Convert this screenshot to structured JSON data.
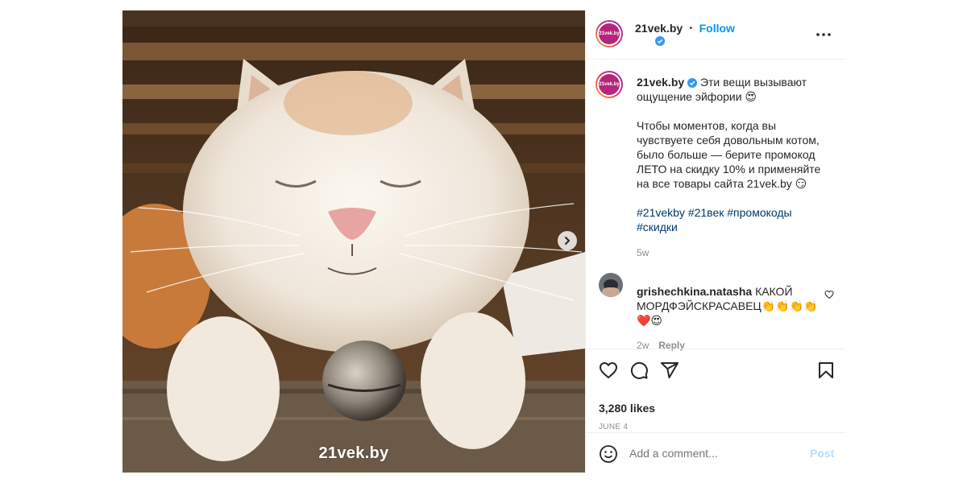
{
  "media": {
    "watermark": "21vek.by"
  },
  "header": {
    "username": "21vek.by",
    "separator": "•",
    "follow_label": "Follow",
    "more_label": "•••",
    "avatar_text": "21vek.by"
  },
  "caption": {
    "username": "21vek.by",
    "line1": "Эти вещи вызывают",
    "line2": "ощущение эйфории 😍",
    "para2_l1": "Чтобы моментов, когда вы",
    "para2_l2": "чувствуете себя довольным котом,",
    "para2_l3": "было больше — берите промокод",
    "para2_l4": "ЛЕТО на скидку 10% и применяйте",
    "para2_l5": "на все товары сайта 21vek.by 😏",
    "hashtags_l1": "#21vekby #21век #промокоды",
    "hashtags_l2": "#скидки",
    "time": "5w"
  },
  "comment": {
    "username": "grishechkina.natasha",
    "text_l1": "КАКОЙ",
    "text_l2": "МОРДФЭЙСКРАСАВЕЦ👏👏👏👏",
    "text_l3": "❤️😍",
    "time": "2w",
    "reply_label": "Reply"
  },
  "actions": {
    "likes": "3,280 likes",
    "date": "JUNE 4"
  },
  "add_comment": {
    "placeholder": "Add a comment...",
    "post_label": "Post"
  },
  "colors": {
    "accent": "#0095f6",
    "hashtag": "#00376b",
    "muted": "#8e8e8e",
    "brand": "#b5267a"
  },
  "icons": [
    "chevron-right-icon",
    "verified-icon",
    "more-icon",
    "heart-icon",
    "comment-icon",
    "share-icon",
    "bookmark-icon",
    "emoji-icon",
    "small-heart-icon"
  ]
}
